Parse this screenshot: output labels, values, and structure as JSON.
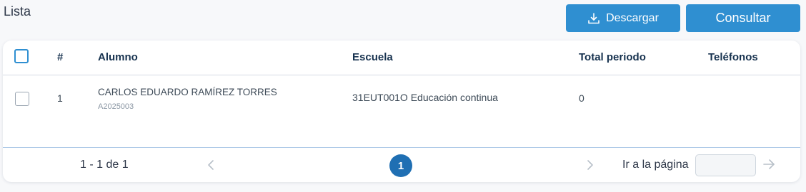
{
  "page": {
    "title": "Lista"
  },
  "toolbar": {
    "download_label": "Descargar",
    "download_icon": "download-icon",
    "consult_label": "Consultar"
  },
  "table": {
    "columns": [
      "#",
      "Alumno",
      "Escuela",
      "Total periodo",
      "Teléfonos"
    ],
    "rows": [
      {
        "number": "1",
        "student_name": "CARLOS EDUARDO RAMÍREZ TORRES",
        "student_id": "A2025003",
        "school": "31EUT001O Educación continua",
        "total_period": "0",
        "phones": ""
      }
    ]
  },
  "pagination": {
    "range": "1 - 1 de 1",
    "current_page": "1",
    "goto_label": "Ir a la página",
    "goto_value": ""
  },
  "colors": {
    "primary": "#2f8fd1",
    "page_active": "#1f6fb3",
    "header_text": "#17324f"
  }
}
